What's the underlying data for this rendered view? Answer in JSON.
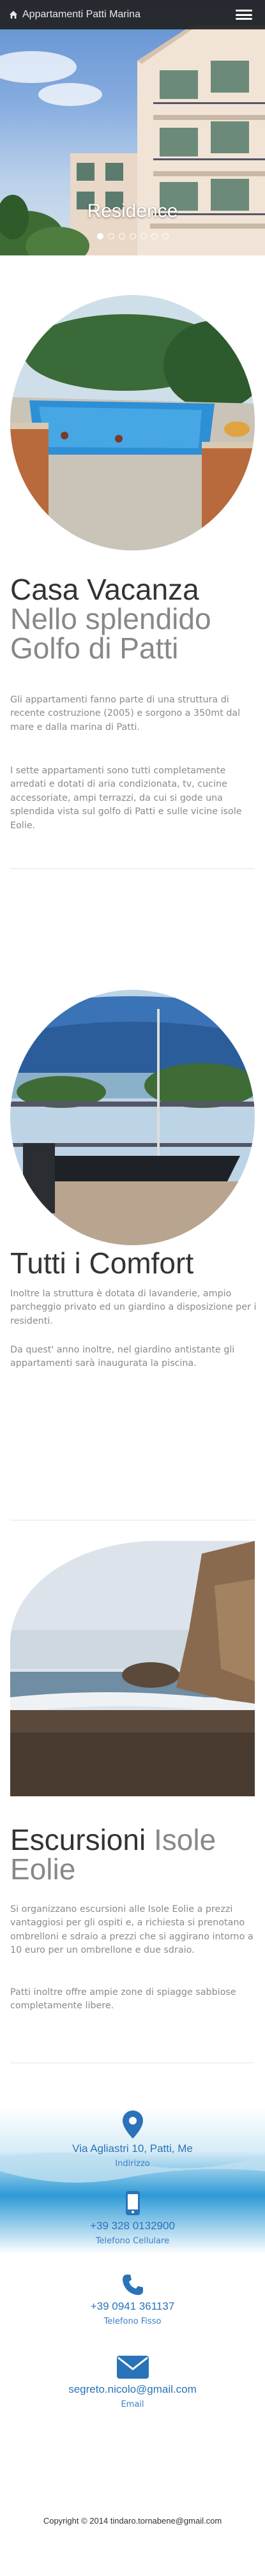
{
  "navbar": {
    "brand": "Appartamenti Patti Marina",
    "brand_icon": "home-icon",
    "menu_icon": "hamburger-menu-icon"
  },
  "hero": {
    "caption": "Residence",
    "slide_count": 7,
    "active_slide": 1
  },
  "sections": [
    {
      "title_main": "Casa Vacanza",
      "title_muted": "Nello splendido Golfo di Patti",
      "paragraphs": [
        "Gli appartamenti fanno parte di una struttura di recente costruzione (2005) e sorgono a 350mt dal mare e dalla marina di Patti.",
        "I sette appartamenti sono tutti completamente arredati e dotati di aria condizionata, tv, cucine accessoriate, ampi terrazzi, da cui si gode una splendida vista sul golfo di Patti e sulle vicine isole Eolie."
      ]
    },
    {
      "title_main": "Tutti i Comfort",
      "title_muted": "",
      "paragraphs": [
        "Inoltre la struttura è dotata di lavanderie, ampio parcheggio privato ed un giardino a disposizione per i residenti.",
        "Da quest' anno inoltre, nel giardino antistante gli appartamenti sarà inaugurata la piscina."
      ]
    },
    {
      "title_main": "Escursioni",
      "title_muted": "Isole Eolie",
      "paragraphs": [
        "Si organizzano escursioni alle Isole Eolie a prezzi vantaggiosi per gli ospiti e, a richiesta si prenotano ombrelloni e sdraio a prezzi che si aggirano intorno a 10 euro per un ombrellone e due sdraio.",
        "Patti inoltre offre ampie zone di spiagge sabbiose completamente libere."
      ]
    }
  ],
  "contacts": [
    {
      "icon": "map-marker-icon",
      "value": "Via Agliastri 10, Patti, Me",
      "label": "Indirizzo"
    },
    {
      "icon": "mobile-phone-icon",
      "value": "+39 328 0132900",
      "label": "Telefono Cellulare"
    },
    {
      "icon": "phone-icon",
      "value": "+39 0941 361137",
      "label": "Telefono Fisso"
    },
    {
      "icon": "envelope-icon",
      "value": "segreto.nicolo@gmail.com",
      "label": "Email"
    }
  ],
  "footer": {
    "text": "Copyright © 2014 tindaro.tornabene@gmail.com"
  },
  "colors": {
    "navbar": "#222222",
    "accent": "#2a73b9",
    "heading": "#333333",
    "muted": "#888888"
  }
}
